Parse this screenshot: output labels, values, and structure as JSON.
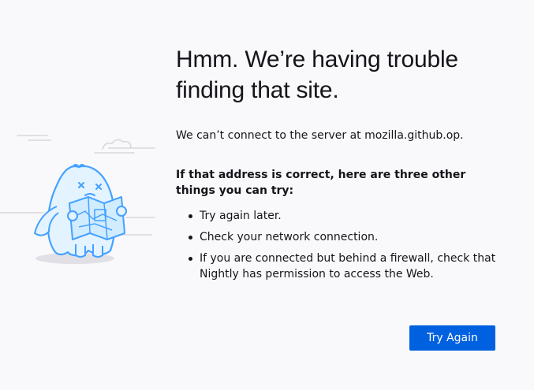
{
  "error": {
    "title": "Hmm. We’re having trouble finding that site.",
    "intro": "We can’t connect to the server at mozilla.github.op.",
    "list_header": "If that address is correct, here are three other things you can try:",
    "tips": [
      "Try again later.",
      "Check your network connection.",
      "If you are connected but behind a firewall, check that Nightly has permission to access the Web."
    ]
  },
  "actions": {
    "try_again_label": "Try Again"
  },
  "colors": {
    "background": "#f9f9fb",
    "primary_button": "#0061e0",
    "illustration_stroke": "#45a1ff",
    "illustration_fill": "#e3f3ff"
  },
  "illustration": {
    "icon": "lost-monster-with-map-icon"
  }
}
